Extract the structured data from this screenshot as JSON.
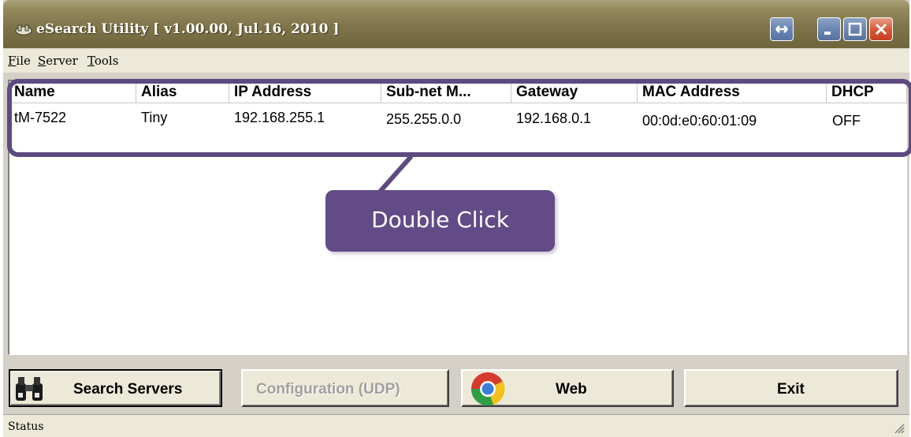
{
  "window": {
    "title": "eSearch Utility [ v1.00.00, Jul.16, 2010 ]",
    "titlebar_color": "#857a4c",
    "close_color": "#d9593a"
  },
  "menu": [
    "File",
    "Server",
    "Tools"
  ],
  "table": {
    "columns": [
      "Name",
      "Alias",
      "IP Address",
      "Sub-net M...",
      "Gateway",
      "MAC Address",
      "DHCP"
    ],
    "rows": [
      [
        "tM-7522",
        "Tiny",
        "192.168.255.1",
        "255.255.0.0",
        "192.168.0.1",
        "00:0d:e0:60:01:09",
        "OFF"
      ]
    ]
  },
  "callout": {
    "text": "Double Click",
    "color": "#634b87"
  },
  "buttons": {
    "search": "Search Servers",
    "config": "Configuration (UDP)",
    "web": "Web",
    "exit": "Exit"
  },
  "status": "Status"
}
